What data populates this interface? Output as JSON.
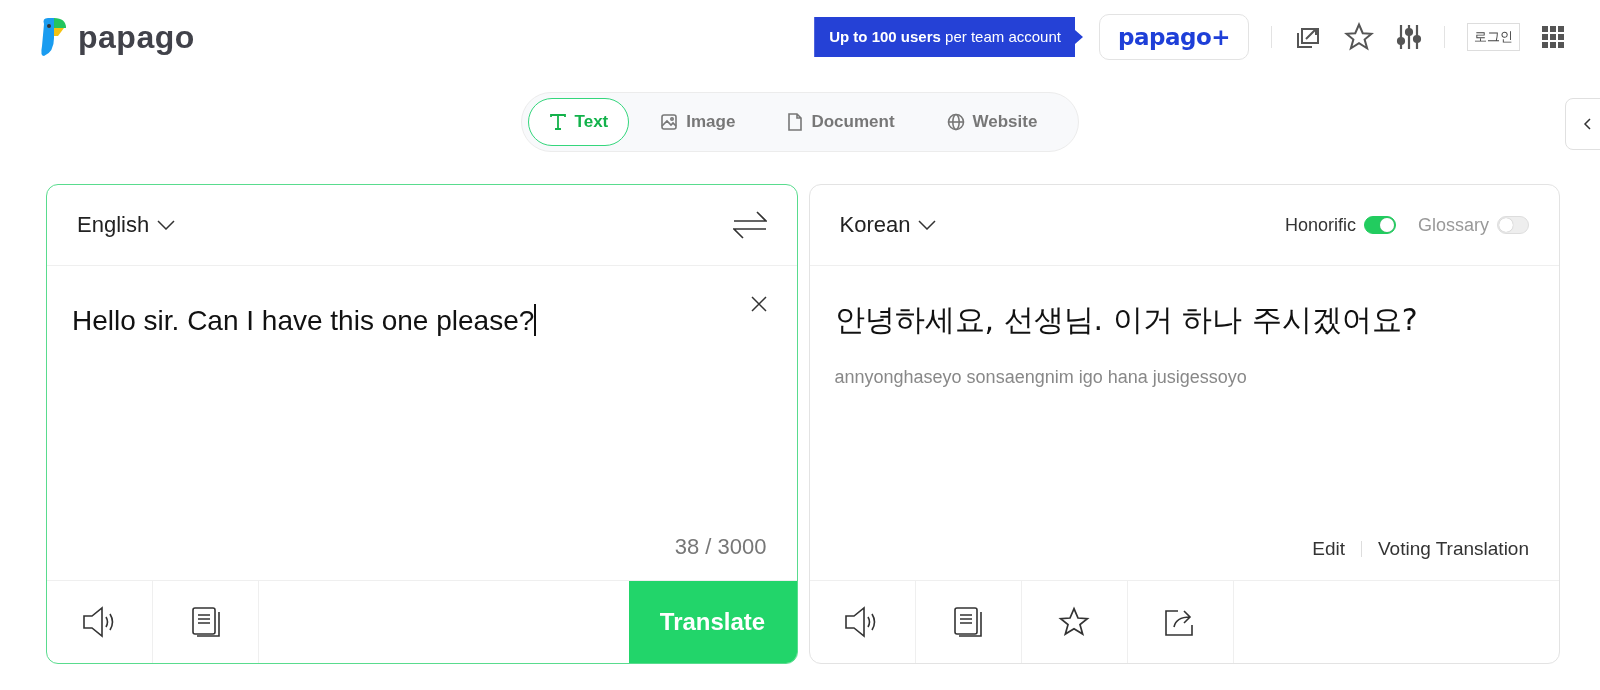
{
  "header": {
    "logo": "papago",
    "promo": "**Up to 100 users** per team account",
    "plus_button": "papago+",
    "login": "로그인"
  },
  "modes": [
    {
      "label": "Text",
      "kind": "text",
      "selected": true
    },
    {
      "label": "Image",
      "kind": "image",
      "selected": false
    },
    {
      "label": "Document",
      "kind": "document",
      "selected": false
    },
    {
      "label": "Website",
      "kind": "website",
      "selected": false
    }
  ],
  "source": {
    "language": "English",
    "text": "Hello sir. Can I have this one please?",
    "count": "38 / 3000",
    "translate_button": "Translate"
  },
  "target": {
    "language": "Korean",
    "options": [
      {
        "label": "Honorific",
        "on": true
      },
      {
        "label": "Glossary",
        "on": false
      }
    ],
    "text": "안녕하세요, 선생님. 이거 하나 주시겠어요?",
    "romanization": "annyonghaseyo sonsaengnim igo hana jusigessoyo",
    "links": [
      "Edit",
      "Voting Translation"
    ]
  }
}
